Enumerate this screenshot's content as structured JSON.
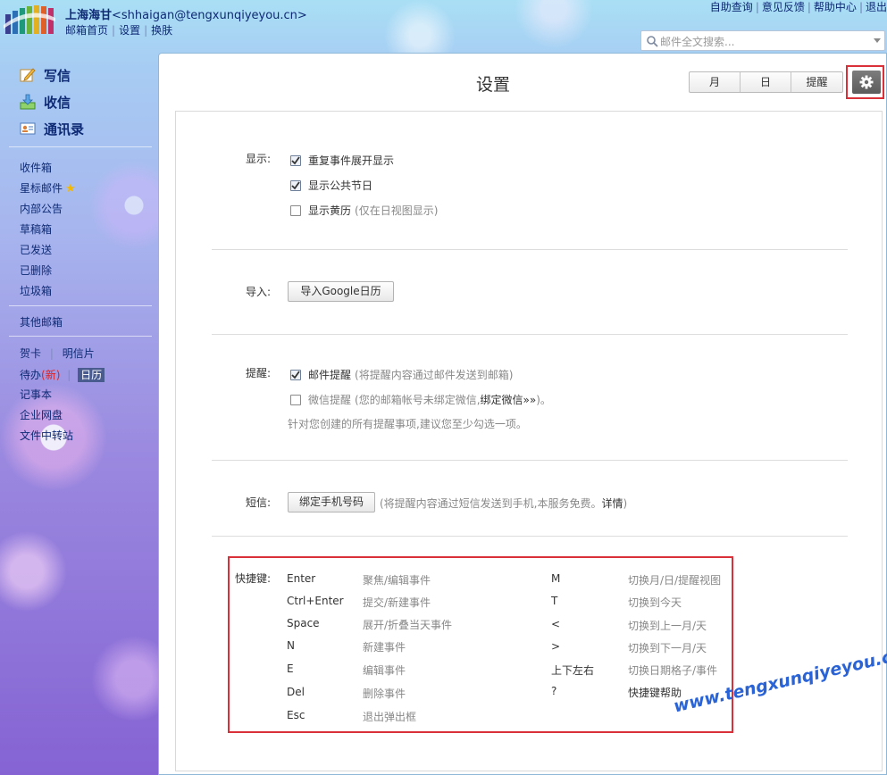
{
  "account": {
    "name": "上海海甘",
    "email": "<shhaigan@tengxunqiyeyou.cn>"
  },
  "header_links": [
    "邮箱首页",
    "设置",
    "换肤"
  ],
  "top_links": [
    "自助查询",
    "意见反馈",
    "帮助中心",
    "退出"
  ],
  "search": {
    "placeholder": "邮件全文搜索..."
  },
  "sidebar": {
    "primary": [
      {
        "label": "写信",
        "icon": "compose-icon"
      },
      {
        "label": "收信",
        "icon": "inbox-download-icon"
      },
      {
        "label": "通讯录",
        "icon": "contacts-card-icon"
      }
    ],
    "folders": [
      "收件箱",
      "星标邮件",
      "内部公告",
      "草稿箱",
      "已发送",
      "已删除",
      "垃圾箱"
    ],
    "other_mail": "其他邮箱",
    "apps": {
      "greeting_card": "贺卡",
      "postcard": "明信片",
      "todo": "待办",
      "todo_new": "(新)",
      "calendar": "日历",
      "notebook": "记事本",
      "netdisk": "企业网盘",
      "file_transfer": "文件中转站"
    }
  },
  "main": {
    "title": "设置",
    "view_buttons": [
      "月",
      "日",
      "提醒"
    ],
    "display": {
      "label": "显示:",
      "options": [
        {
          "label": "重复事件展开显示",
          "checked": true,
          "hint": ""
        },
        {
          "label": "显示公共节日",
          "checked": true,
          "hint": ""
        },
        {
          "label": "显示黄历",
          "checked": false,
          "hint": "(仅在日视图显示)"
        }
      ]
    },
    "import": {
      "label": "导入:",
      "button": "导入Google日历"
    },
    "reminder": {
      "label": "提醒:",
      "mail": {
        "label": "邮件提醒",
        "checked": true,
        "hint": "(将提醒内容通过邮件发送到邮箱)"
      },
      "wechat": {
        "label": "微信提醒",
        "checked": false,
        "hint_prefix": "(您的邮箱帐号未绑定微信,",
        "link": "绑定微信»»",
        "hint_suffix": ")。"
      },
      "note": "针对您创建的所有提醒事项,建议您至少勾选一项。"
    },
    "sms": {
      "label": "短信:",
      "button": "绑定手机号码",
      "hint_prefix": "(将提醒内容通过短信发送到手机,本服务免费。",
      "link": "详情",
      "hint_suffix": ")"
    },
    "shortcuts": {
      "label": "快捷键:",
      "left": [
        {
          "key": "Enter",
          "desc": "聚焦/编辑事件"
        },
        {
          "key": "Ctrl+Enter",
          "desc": "提交/新建事件"
        },
        {
          "key": "Space",
          "desc": "展开/折叠当天事件"
        },
        {
          "key": "N",
          "desc": "新建事件"
        },
        {
          "key": "E",
          "desc": "编辑事件"
        },
        {
          "key": "Del",
          "desc": "删除事件"
        },
        {
          "key": "Esc",
          "desc": "退出弹出框"
        }
      ],
      "right": [
        {
          "key": "M",
          "desc": "切换月/日/提醒视图"
        },
        {
          "key": "T",
          "desc": "切换到今天"
        },
        {
          "key": "<",
          "desc": "切换到上一月/天"
        },
        {
          "key": ">",
          "desc": "切换到下一月/天"
        },
        {
          "key": "上下左右",
          "desc": "切换日期格子/事件"
        },
        {
          "key": "?",
          "desc": "快捷键帮助"
        }
      ]
    }
  },
  "watermark": "www.tengxunqiyeyou.com"
}
